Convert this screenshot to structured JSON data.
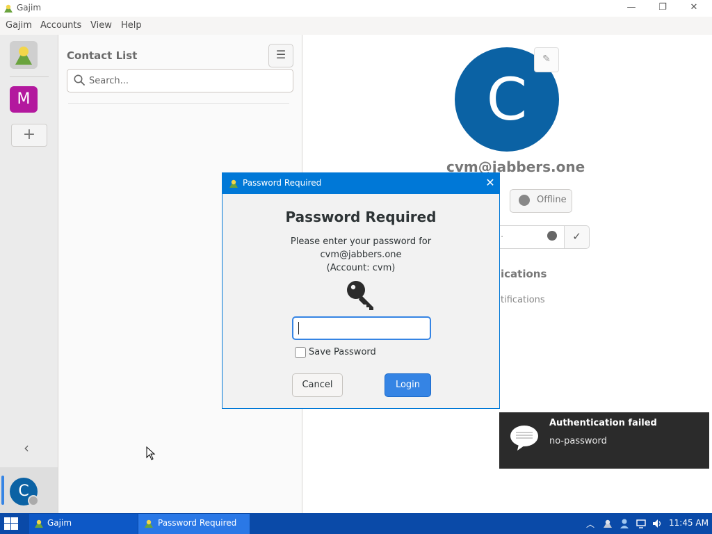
{
  "window": {
    "title": "Gajim",
    "buttons": {
      "minimize": "—",
      "restore": "❐",
      "close": "✕"
    }
  },
  "menu": [
    "Gajim",
    "Accounts",
    "View",
    "Help"
  ],
  "rail": {
    "account_letter": "M",
    "add": "+",
    "collapse": "‹",
    "self_letter": "C"
  },
  "contact_list": {
    "title": "Contact List",
    "menu_icon": "☰",
    "search_placeholder": "Search..."
  },
  "profile": {
    "avatar_letter": "C",
    "edit_icon": "✎",
    "jid": "cvm@jabbers.one",
    "status": "Offline",
    "message_ellipsis": ".",
    "confirm_icon": "✓",
    "notifications_heading": "ications",
    "notifications_sub": "tifications"
  },
  "dialog": {
    "window_title": "Password Required",
    "close": "✕",
    "heading": "Password Required",
    "line1": "Please enter your password for",
    "line2": "cvm@jabbers.one",
    "line3": "(Account: cvm)",
    "save_label": "Save Password",
    "cancel": "Cancel",
    "login": "Login"
  },
  "toast": {
    "title": "Authentication failed",
    "body": "no-password"
  },
  "taskbar": {
    "apps": [
      "Gajim",
      "Password Required"
    ],
    "tray_up": "︿",
    "time": "11:45 AM"
  },
  "colors": {
    "accent": "#0078d7",
    "avatar": "#0b62a4",
    "account_m": "#b3189e",
    "taskbar": "#0a4aa8",
    "login_button": "#3584e4"
  }
}
